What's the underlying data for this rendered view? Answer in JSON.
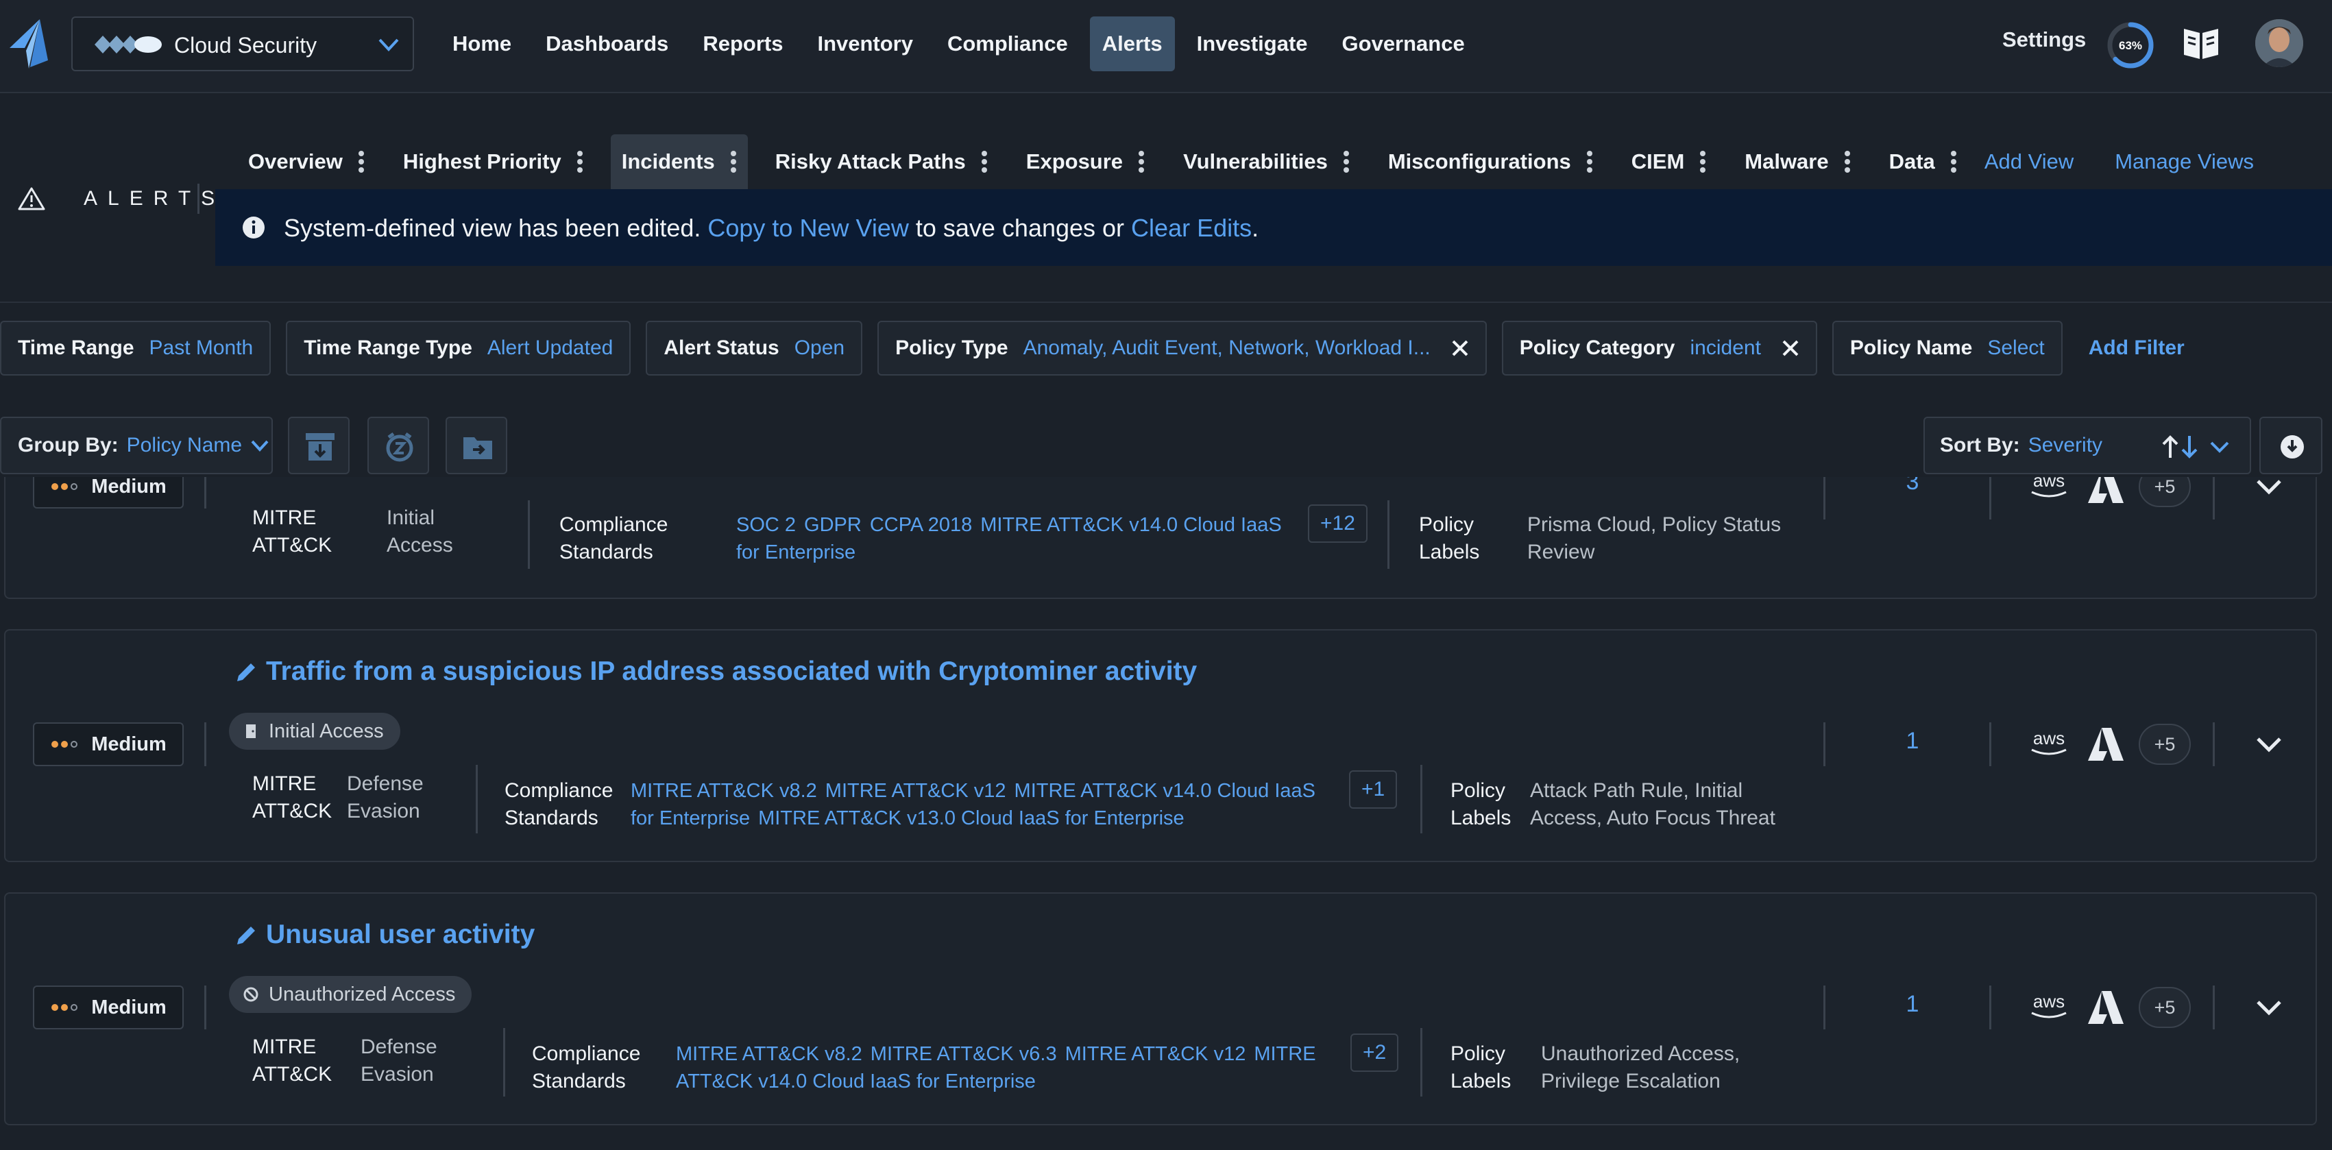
{
  "topnav": {
    "tenant": "Cloud Security",
    "menu": [
      {
        "label": "Home",
        "active": false
      },
      {
        "label": "Dashboards",
        "active": false
      },
      {
        "label": "Reports",
        "active": false
      },
      {
        "label": "Inventory",
        "active": false
      },
      {
        "label": "Compliance",
        "active": false
      },
      {
        "label": "Alerts",
        "active": true
      },
      {
        "label": "Investigate",
        "active": false
      },
      {
        "label": "Governance",
        "active": false
      }
    ],
    "settings": "Settings",
    "progress_label": "63%",
    "progress_value": 0.63
  },
  "section": {
    "title": "ALERTS"
  },
  "view_tabs": [
    {
      "label": "Overview",
      "active": false
    },
    {
      "label": "Highest Priority",
      "active": false
    },
    {
      "label": "Incidents",
      "active": true
    },
    {
      "label": "Risky Attack Paths",
      "active": false
    },
    {
      "label": "Exposure",
      "active": false
    },
    {
      "label": "Vulnerabilities",
      "active": false
    },
    {
      "label": "Misconfigurations",
      "active": false
    },
    {
      "label": "CIEM",
      "active": false
    },
    {
      "label": "Malware",
      "active": false
    },
    {
      "label": "Data",
      "active": false
    }
  ],
  "view_links": {
    "add": "Add View",
    "manage": "Manage Views"
  },
  "banner": {
    "text_before": "System-defined view has been edited. ",
    "link1": "Copy to New View",
    "text_middle": " to save changes or ",
    "link2": "Clear Edits",
    "text_after": "."
  },
  "filters": [
    {
      "key": "Time Range",
      "value": "Past Month",
      "removable": false
    },
    {
      "key": "Time Range Type",
      "value": "Alert Updated",
      "removable": false
    },
    {
      "key": "Alert Status",
      "value": "Open",
      "removable": false
    },
    {
      "key": "Policy Type",
      "value": "Anomaly, Audit Event, Network, Workload I...",
      "removable": true
    },
    {
      "key": "Policy Category",
      "value": "incident",
      "removable": true
    },
    {
      "key": "Policy Name",
      "value": "Select",
      "removable": false
    }
  ],
  "add_filter": "Add Filter",
  "toolbar": {
    "group_by_label": "Group By:",
    "group_by_value": "Policy Name",
    "sort_by_label": "Sort By:",
    "sort_by_value": "Severity"
  },
  "alerts": [
    {
      "severity": "Medium",
      "title": "",
      "tactic": "",
      "mitre_label": "MITRE ATT&CK",
      "mitre_value": "Initial Access",
      "compliance_label": "Compliance Standards",
      "standards": [
        "SOC 2",
        "GDPR",
        "CCPA 2018",
        "MITRE ATT&CK v14.0 Cloud IaaS for Enterprise"
      ],
      "standards_more": "+12",
      "labels_label": "Policy Labels",
      "labels_value": "Prisma Cloud, Policy Status Review",
      "count": "3",
      "clouds_more": "+5"
    },
    {
      "severity": "Medium",
      "title": "Traffic from a suspicious IP address associated with Cryptominer activity",
      "tactic": "Initial Access",
      "mitre_label": "MITRE ATT&CK",
      "mitre_value": "Defense Evasion",
      "compliance_label": "Compliance Standards",
      "standards": [
        "MITRE ATT&CK v8.2",
        "MITRE ATT&CK v12",
        "MITRE ATT&CK v14.0 Cloud IaaS for Enterprise",
        "MITRE ATT&CK v13.0 Cloud IaaS for Enterprise"
      ],
      "standards_more": "+1",
      "labels_label": "Policy Labels",
      "labels_value": "Attack Path Rule, Initial Access, Auto Focus Threat",
      "count": "1",
      "clouds_more": "+5"
    },
    {
      "severity": "Medium",
      "title": "Unusual user activity",
      "tactic": "Unauthorized Access",
      "mitre_label": "MITRE ATT&CK",
      "mitre_value": "Defense Evasion",
      "compliance_label": "Compliance Standards",
      "standards": [
        "MITRE ATT&CK v8.2",
        "MITRE ATT&CK v6.3",
        "MITRE ATT&CK v12",
        "MITRE ATT&CK v14.0 Cloud IaaS for Enterprise"
      ],
      "standards_more": "+2",
      "labels_label": "Policy Labels",
      "labels_value": "Unauthorized Access, Privilege Escalation",
      "count": "1",
      "clouds_more": "+5"
    }
  ],
  "cloud_icons": [
    "aws-icon",
    "azure-icon"
  ],
  "colors": {
    "accent": "#5aa2f0",
    "background": "#1b2129",
    "severity_medium": "#f0a04b"
  }
}
